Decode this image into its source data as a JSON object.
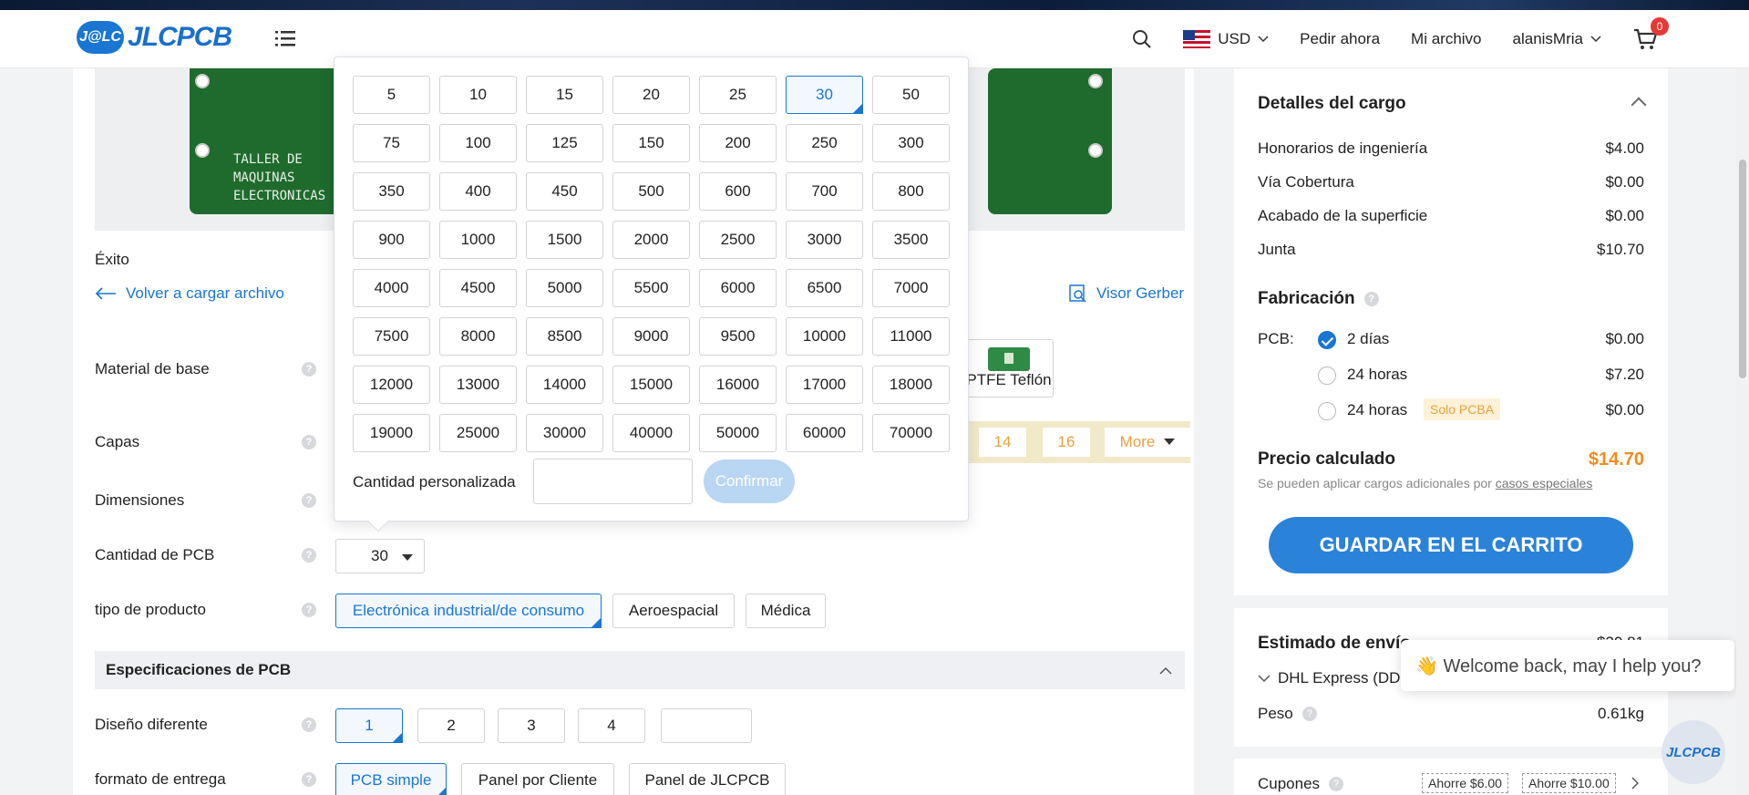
{
  "header": {
    "logo_badge": "J@LC",
    "logo_text": "JLCPCB",
    "currency": "USD",
    "nav_order": "Pedir ahora",
    "nav_files": "Mi archivo",
    "username": "alanisMria",
    "cart_count": "0"
  },
  "preview": {
    "board_text_1": "TALLER DE",
    "board_text_2": "MAQUINAS",
    "board_text_3": "ELECTRONICAS"
  },
  "upload": {
    "status": "Éxito",
    "reload_link": "Volver a cargar archivo",
    "gerber_viewer": "Visor Gerber"
  },
  "form": {
    "base_material_label": "Material de base",
    "ptfe_label": "PTFE Teflón",
    "layers_label": "Capas",
    "layer_options": [
      "14",
      "16"
    ],
    "layer_more": "More",
    "dimensions_label": "Dimensiones",
    "qty_label": "Cantidad de PCB",
    "qty_value": "30",
    "product_type_label": "tipo de producto",
    "product_types": [
      "Electrónica industrial/de consumo",
      "Aeroespacial",
      "Médica"
    ],
    "specs_section": "Especificaciones de PCB",
    "different_design_label": "Diseño diferente",
    "different_design_options": [
      "1",
      "2",
      "3",
      "4"
    ],
    "delivery_format_label": "formato de entrega",
    "delivery_formats": [
      "PCB simple",
      "Panel por Cliente",
      "Panel de JLCPCB"
    ]
  },
  "qty_popup": {
    "options": [
      "5",
      "10",
      "15",
      "20",
      "25",
      "30",
      "50",
      "75",
      "100",
      "125",
      "150",
      "200",
      "250",
      "300",
      "350",
      "400",
      "450",
      "500",
      "600",
      "700",
      "800",
      "900",
      "1000",
      "1500",
      "2000",
      "2500",
      "3000",
      "3500",
      "4000",
      "4500",
      "5000",
      "5500",
      "6000",
      "6500",
      "7000",
      "7500",
      "8000",
      "8500",
      "9000",
      "9500",
      "10000",
      "11000",
      "12000",
      "13000",
      "14000",
      "15000",
      "16000",
      "17000",
      "18000",
      "19000",
      "25000",
      "30000",
      "40000",
      "50000",
      "60000",
      "70000"
    ],
    "selected": "30",
    "custom_label": "Cantidad personalizada",
    "custom_value": "",
    "confirm": "Confirmar"
  },
  "charges": {
    "title": "Detalles del cargo",
    "items": [
      {
        "label": "Honorarios de ingeniería",
        "value": "$4.00"
      },
      {
        "label": "Vía Cobertura",
        "value": "$0.00"
      },
      {
        "label": "Acabado de la superficie",
        "value": "$0.00"
      },
      {
        "label": "Junta",
        "value": "$10.70"
      }
    ],
    "fabrication_title": "Fabricación",
    "pcb_label": "PCB:",
    "build_options": [
      {
        "label": "2 días",
        "value": "$0.00"
      },
      {
        "label": "24 horas",
        "value": "$7.20"
      },
      {
        "label": "24 horas",
        "value": "$0.00",
        "tag": "Solo PCBA"
      }
    ],
    "calc_price_label": "Precio calculado",
    "calc_price": "$14.70",
    "note_prefix": "Se pueden aplicar cargos adicionales por",
    "note_link": "casos especiales",
    "save_button": "GUARDAR EN EL CARRITO"
  },
  "shipping": {
    "title": "Estimado de envío",
    "cost_partial": "$30.81",
    "method": "DHL Express (DDP)",
    "weight_label": "Peso",
    "weight_value": "0.61kg"
  },
  "coupons": {
    "label": "Cupones",
    "items": [
      "Ahorre $6.00",
      "Ahorre $10.00"
    ]
  },
  "chat": {
    "greeting": "👋 Welcome back, may I help you?",
    "avatar_text": "JLCPCB"
  }
}
